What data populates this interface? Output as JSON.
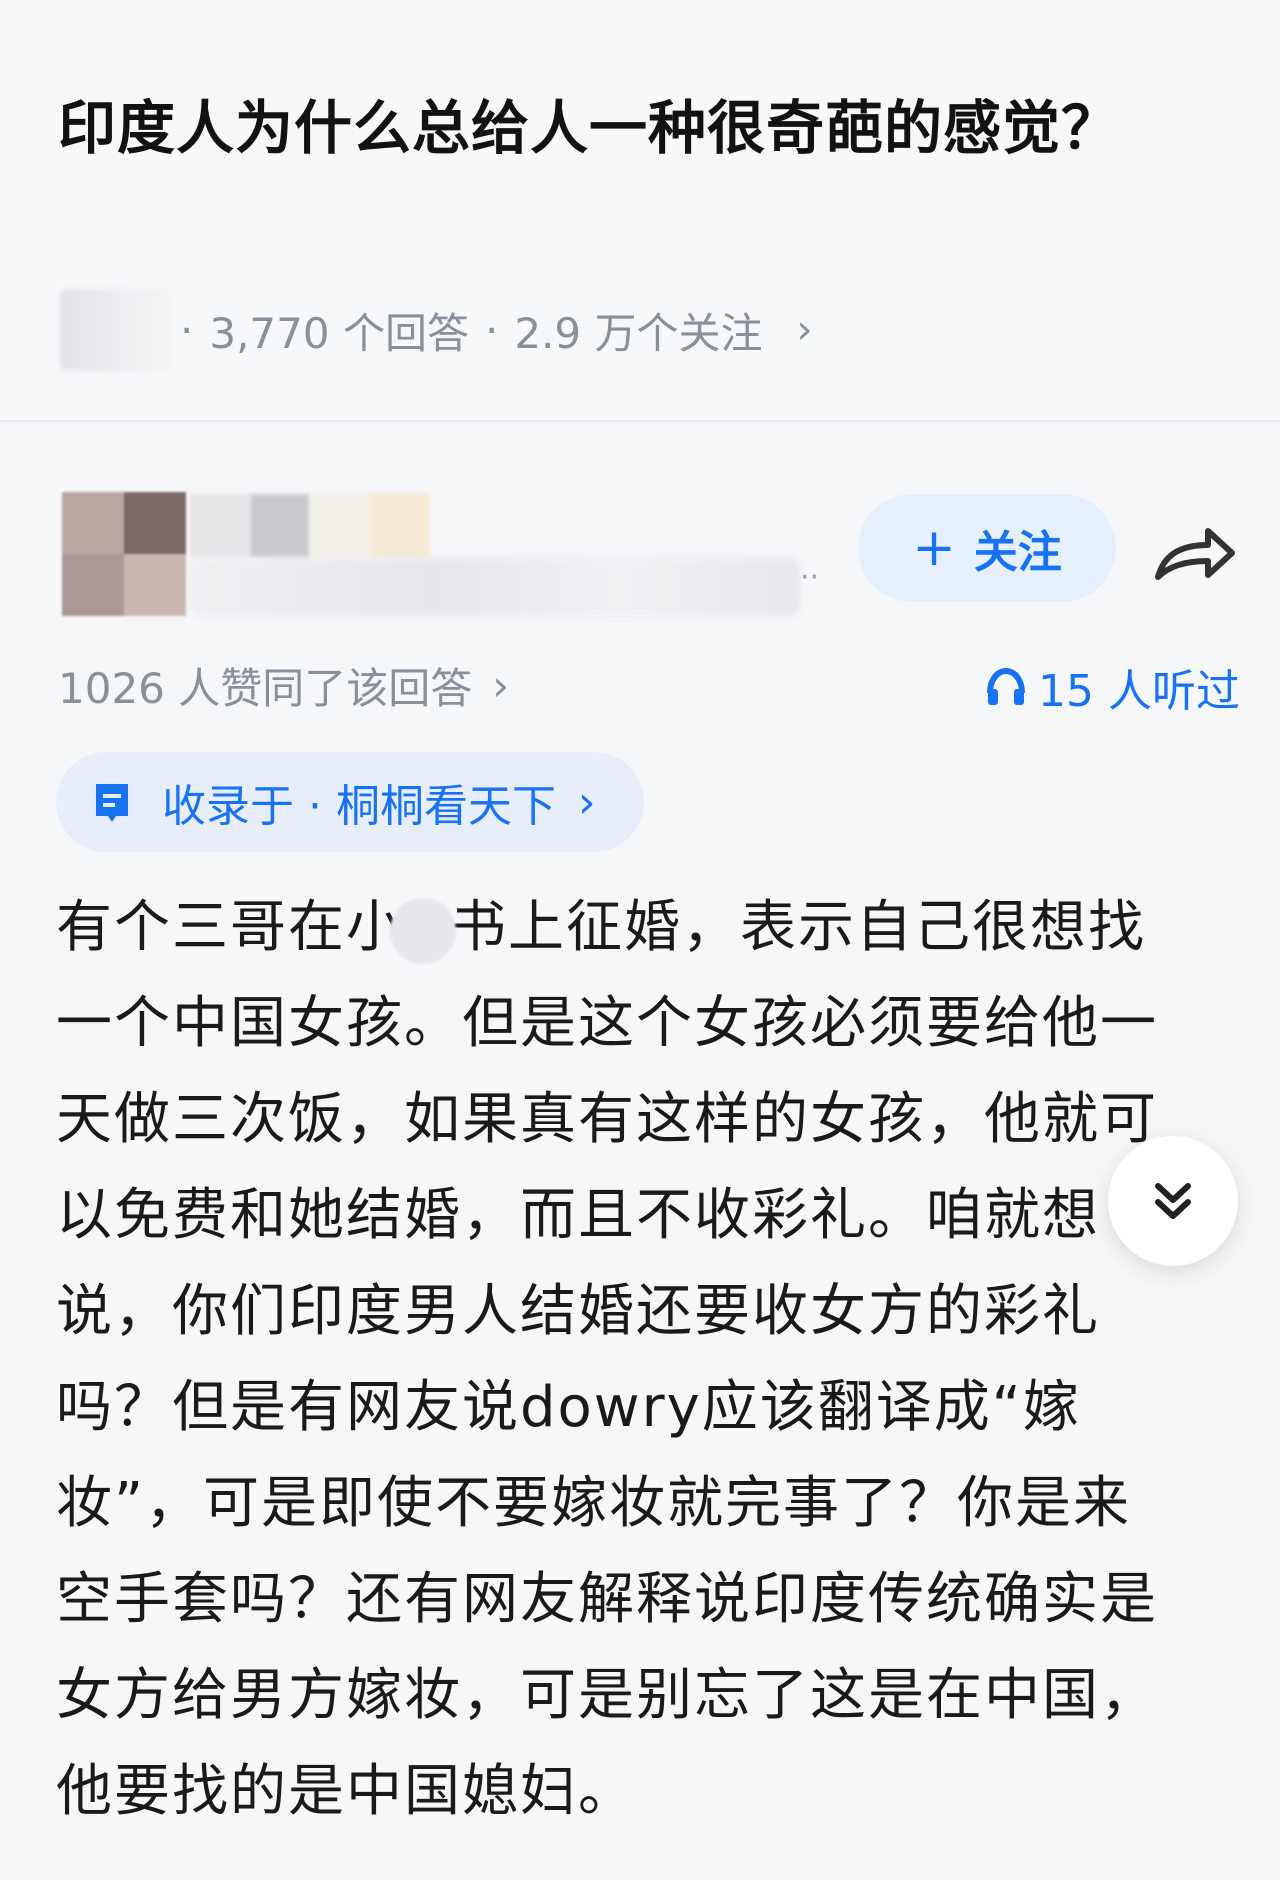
{
  "question": {
    "title": "印度人为什么总给人一种很奇葩的感觉？",
    "answers_count": "3,770 个回答",
    "followers_count": "2.9 万个关注",
    "separator": "·",
    "chevron": "›"
  },
  "author": {
    "follow_label": "关注",
    "follow_plus": "+",
    "ellipsis": "··"
  },
  "stats": {
    "likes_text": "1026 人赞同了该回答",
    "likes_chevron": "›",
    "listen_text": "15 人听过"
  },
  "collection": {
    "text": "收录于 · 桐桐看天下",
    "chevron": "›"
  },
  "answer": {
    "lines": [
      [
        "有个三哥在小",
        "书上征婚，表示自己很想找"
      ],
      "一个中国女孩。但是这个女孩必须要给他一",
      "天做三次饭，如果真有这样的女孩，他就可",
      "以免费和她结婚，而且不收彩礼。咱就想",
      "说，你们印度男人结婚还要收女方的彩礼",
      "吗？但是有网友说dowry应该翻译成“嫁",
      "妆”，可是即使不要嫁妆就完事了？你是来",
      "空手套吗？还有网友解释说印度传统确实是",
      "女方给男方嫁妆，可是别忘了这是在中国，",
      "他要找的是中国媳妇。"
    ]
  },
  "colors": {
    "accent": "#1772f6",
    "muted": "#8a8f99",
    "background": "#f6f7f9"
  },
  "icons": {
    "share": "share-arrow-icon",
    "headphones": "headphones-icon",
    "collection": "collection-bookmark-icon",
    "expand": "double-chevron-down-icon"
  }
}
